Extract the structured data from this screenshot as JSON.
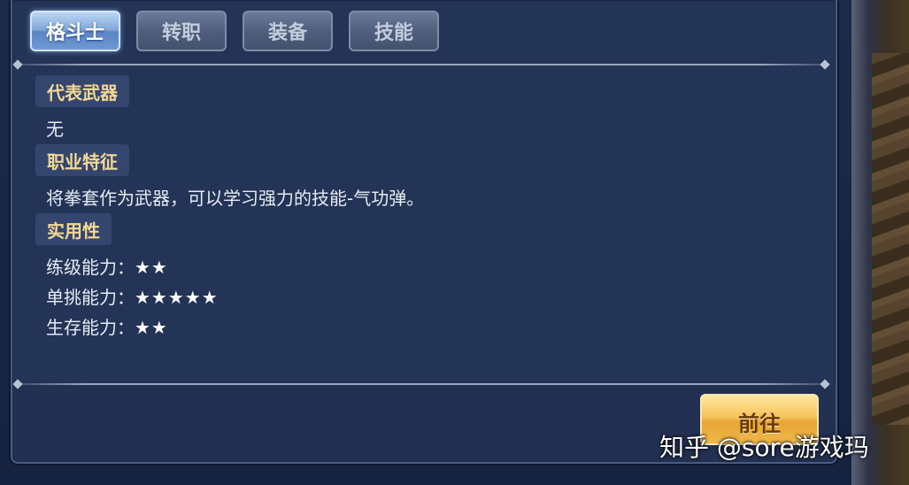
{
  "tabs": [
    {
      "label": "格斗士",
      "active": true
    },
    {
      "label": "转职",
      "active": false
    },
    {
      "label": "装备",
      "active": false
    },
    {
      "label": "技能",
      "active": false
    }
  ],
  "sections": {
    "weapon": {
      "title": "代表武器",
      "text": "无"
    },
    "feature": {
      "title": "职业特征",
      "text": "将拳套作为武器，可以学习强力的技能-气功弹。"
    },
    "utility": {
      "title": "实用性",
      "ratings": [
        {
          "label": "练级能力：",
          "stars": "★★",
          "value": 2
        },
        {
          "label": "单挑能力：",
          "stars": "★★★★★",
          "value": 5
        },
        {
          "label": "生存能力：",
          "stars": "★★",
          "value": 2
        }
      ]
    }
  },
  "go_button": {
    "label": "前往"
  },
  "watermark": "知乎 @sore游戏玛",
  "colors": {
    "panel": "#243457",
    "section_title": "#f3d894",
    "tab_active": "#7fa6d8",
    "button": "#f5c35a"
  }
}
